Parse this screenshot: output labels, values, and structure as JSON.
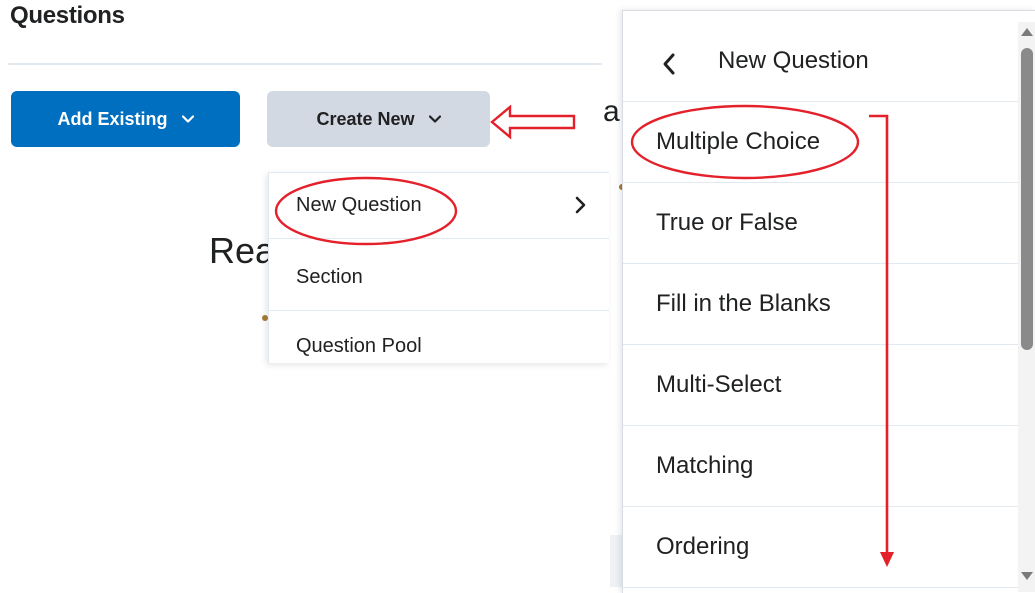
{
  "page": {
    "title": "Questions",
    "background_fragments": {
      "rea": "Rea",
      "a": "a"
    }
  },
  "toolbar": {
    "add_existing_label": "Add Existing",
    "create_new_label": "Create New"
  },
  "dropdown": {
    "items": [
      {
        "label": "New Question",
        "has_submenu": true
      },
      {
        "label": "Section"
      },
      {
        "label": "Question Pool"
      }
    ]
  },
  "submenu": {
    "title": "New Question",
    "items": [
      {
        "label": "Multiple Choice"
      },
      {
        "label": "True or False"
      },
      {
        "label": "Fill in the Blanks"
      },
      {
        "label": "Multi-Select"
      },
      {
        "label": "Matching"
      },
      {
        "label": "Ordering"
      }
    ]
  },
  "icons": {
    "chevron_down": "chevron-down-icon",
    "chevron_right": "chevron-right-icon",
    "chevron_left": "chevron-left-icon"
  },
  "colors": {
    "primary_button": "#006fbf",
    "secondary_button": "#d3d9e3",
    "annotation": "#e4202a"
  }
}
